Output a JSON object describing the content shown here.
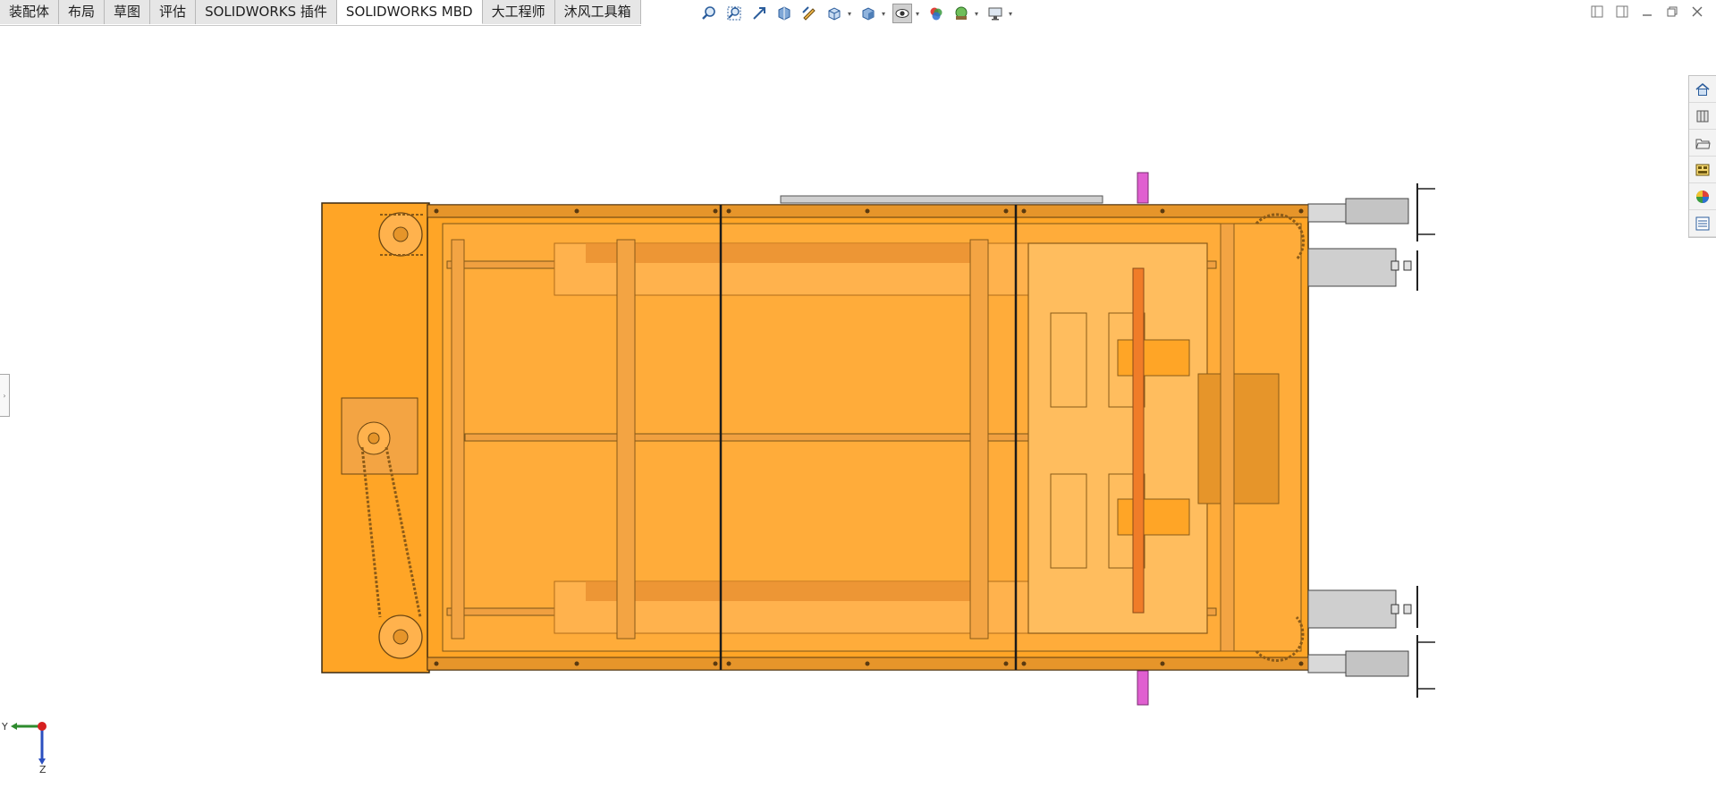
{
  "tabs": [
    {
      "label": "装配体",
      "active": false
    },
    {
      "label": "布局",
      "active": false
    },
    {
      "label": "草图",
      "active": false
    },
    {
      "label": "评估",
      "active": false
    },
    {
      "label": "SOLIDWORKS 插件",
      "active": false
    },
    {
      "label": "SOLIDWORKS MBD",
      "active": true
    },
    {
      "label": "大工程师",
      "active": false
    },
    {
      "label": "沐风工具箱",
      "active": false
    }
  ],
  "toolbar_icons": [
    "zoom-to-fit-icon",
    "zoom-to-area-icon",
    "previous-view-icon",
    "section-view-icon",
    "dynamic-annotation-icon",
    "view-orientation-icon",
    "display-style-icon",
    "hide-show-items-icon",
    "edit-appearance-icon",
    "apply-scene-icon",
    "view-settings-icon"
  ],
  "window_controls": [
    "tile-left-icon",
    "tile-right-icon",
    "minimize-icon",
    "restore-icon",
    "close-icon"
  ],
  "task_pane_icons": [
    "solidworks-resources-icon",
    "design-library-icon",
    "file-explorer-icon",
    "view-palette-icon",
    "appearances-icon",
    "custom-properties-icon"
  ],
  "triad": {
    "y_label": "Y",
    "z_label": "Z"
  },
  "colors": {
    "body": "#ffa526",
    "frame": "#e6952a",
    "outline": "#3c2a10",
    "pink": "#e05fd0",
    "steel": "#c8c8c8"
  }
}
